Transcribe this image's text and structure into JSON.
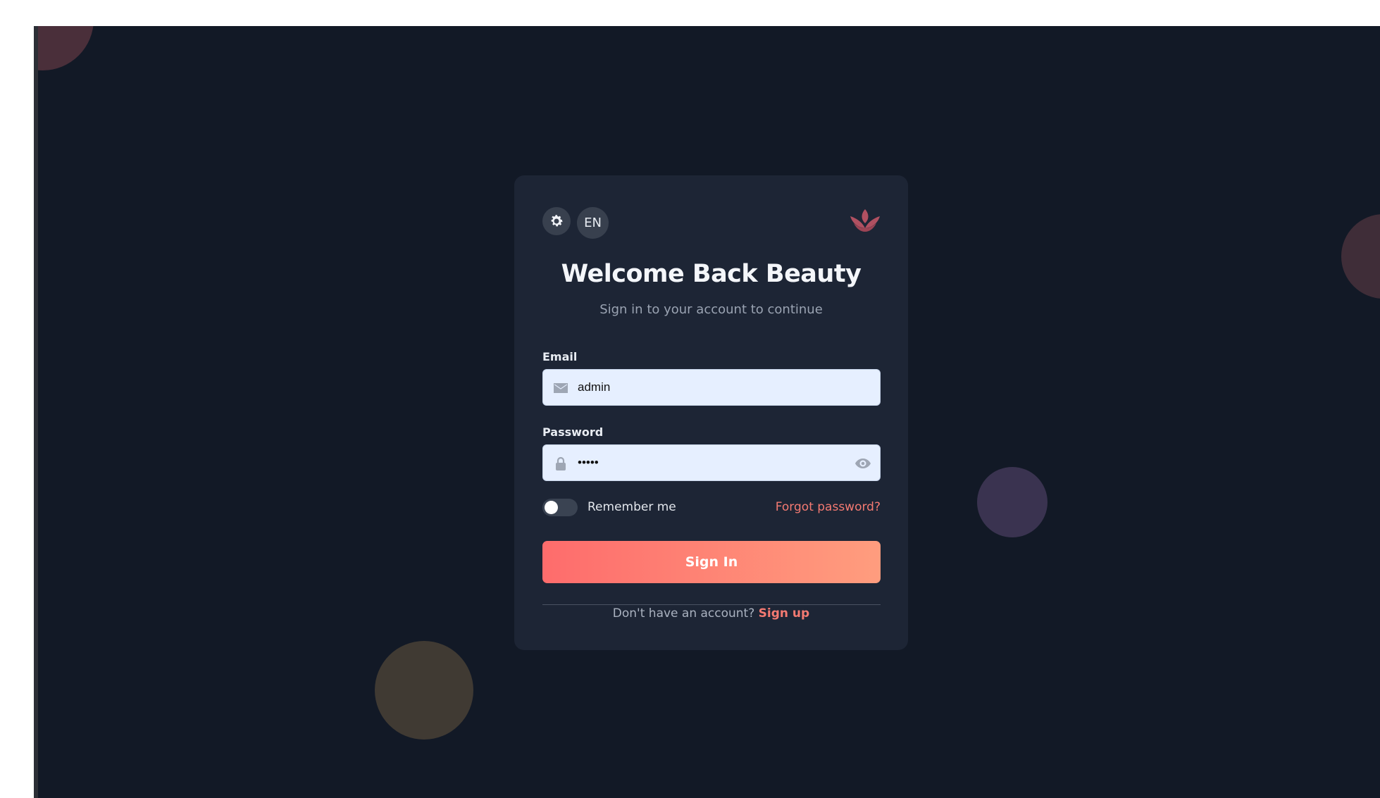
{
  "colors": {
    "background": "#121926",
    "card": "#1d2535",
    "accent": "#fe6c6c",
    "accent_end": "#ff9d7e",
    "input_bg": "#e6efff"
  },
  "header": {
    "theme_icon": "gear-icon",
    "language_label": "EN",
    "logo_icon": "lotus-icon"
  },
  "login": {
    "title": "Welcome Back Beauty",
    "subtitle": "Sign in to your account to continue",
    "email_label": "Email",
    "email_icon": "envelope-icon",
    "email_value": "admin",
    "password_label": "Password",
    "password_icon": "lock-icon",
    "password_value": "admin",
    "password_visibility_icon": "eye-icon",
    "remember_label": "Remember me",
    "remember_checked": false,
    "forgot_label": "Forgot password?",
    "submit_label": "Sign In",
    "signup_prompt": "Don't have an account?",
    "signup_link": "Sign up"
  }
}
